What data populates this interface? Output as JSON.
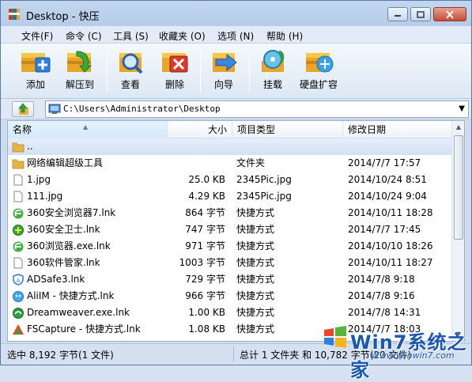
{
  "window": {
    "title": "Desktop - 快压"
  },
  "menu": [
    "文件(F)",
    "命令 (C)",
    "工具 (S)",
    "收藏夹 (O)",
    "选项 (N)",
    "帮助 (H)"
  ],
  "toolbar": {
    "add": "添加",
    "extract": "解压到",
    "view": "查看",
    "delete": "删除",
    "wizard": "向导",
    "mount": "挂载",
    "disk_expand": "硬盘扩容"
  },
  "address": {
    "path": "C:\\Users\\Administrator\\Desktop"
  },
  "columns": {
    "name": "名称",
    "size": "大小",
    "type": "项目类型",
    "date": "修改日期"
  },
  "rows": [
    {
      "name": "..",
      "size": "",
      "type": "",
      "date": "",
      "icon": "folder-up-icon"
    },
    {
      "name": "网络编辑超级工具",
      "size": "",
      "type": "文件夹",
      "date": "2014/7/7 17:57",
      "icon": "folder-icon"
    },
    {
      "name": "1.jpg",
      "size": "25.0 KB",
      "type": "2345Pic.jpg",
      "date": "2014/10/24 8:51",
      "icon": "file-icon"
    },
    {
      "name": "111.jpg",
      "size": "4.29 KB",
      "type": "2345Pic.jpg",
      "date": "2014/10/24 9:04",
      "icon": "file-icon"
    },
    {
      "name": "360安全浏览器7.lnk",
      "size": "864 字节",
      "type": "快捷方式",
      "date": "2014/10/11 18:28",
      "icon": "ie-browser-icon"
    },
    {
      "name": "360安全卫士.lnk",
      "size": "747 字节",
      "type": "快捷方式",
      "date": "2014/7/7 17:45",
      "icon": "shield-360-icon"
    },
    {
      "name": "360浏览器.exe.lnk",
      "size": "971 字节",
      "type": "快捷方式",
      "date": "2014/10/10 18:26",
      "icon": "ie-browser-icon"
    },
    {
      "name": "360软件管家.lnk",
      "size": "1003 字节",
      "type": "快捷方式",
      "date": "2014/10/11 18:27",
      "icon": "file-icon"
    },
    {
      "name": "ADSafe3.lnk",
      "size": "729 字节",
      "type": "快捷方式",
      "date": "2014/7/8 9:18",
      "icon": "adsafe-icon"
    },
    {
      "name": "AliIM - 快捷方式.lnk",
      "size": "966 字节",
      "type": "快捷方式",
      "date": "2014/7/8 9:16",
      "icon": "aliim-icon"
    },
    {
      "name": "Dreamweaver.exe.lnk",
      "size": "1.00 KB",
      "type": "快捷方式",
      "date": "2014/7/8 14:31",
      "icon": "dreamweaver-icon"
    },
    {
      "name": "FSCapture - 快捷方式.lnk",
      "size": "1.08 KB",
      "type": "快捷方式",
      "date": "2014/7/7 18:03",
      "icon": "fscapture-icon"
    }
  ],
  "status": {
    "left": "选中 8,192 字节(1 文件)",
    "right": "总计 1 文件夹 和 10,782 字节(20 文件)"
  },
  "watermark": {
    "text": "Win7系统之家",
    "url": "Www.Winwin7.com"
  }
}
